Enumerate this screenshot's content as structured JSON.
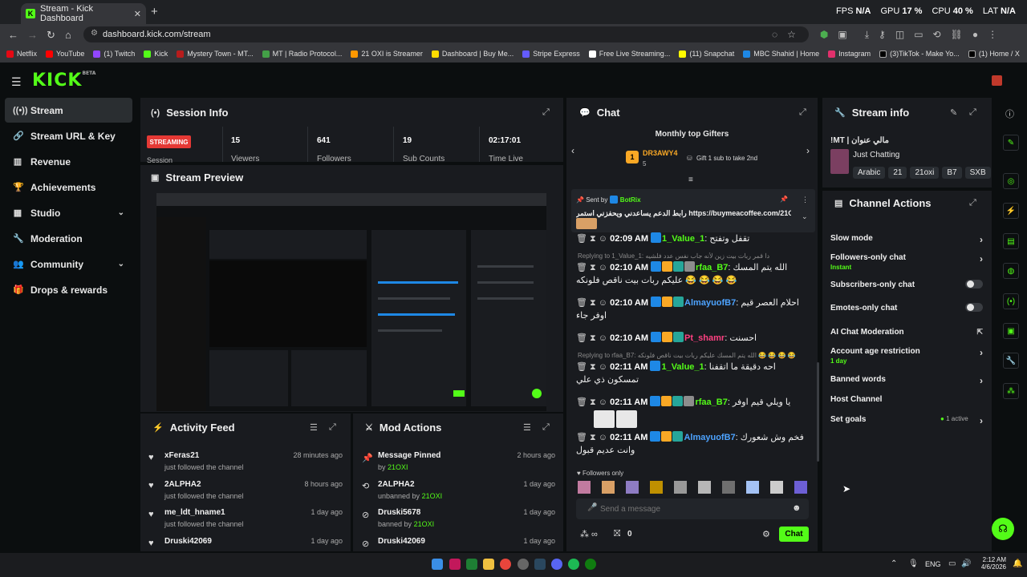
{
  "browser": {
    "tab_title": "Stream - Kick Dashboard",
    "url": "dashboard.kick.com/stream",
    "stats": {
      "fps_label": "FPS",
      "fps": "N/A",
      "gpu_label": "GPU",
      "gpu": "17 %",
      "cpu_label": "CPU",
      "cpu": "40 %",
      "lat_label": "LAT",
      "lat": "N/A"
    },
    "bookmarks": [
      "Netflix",
      "YouTube",
      "(1) Twitch",
      "Kick",
      "Mystery Town - MT...",
      "MT | Radio Protocol...",
      "21 OXI is Streamer",
      "Dashboard | Buy Me...",
      "Stripe Express",
      "Free Live Streaming...",
      "(11) Snapchat",
      "MBC Shahid | Home",
      "Instagram",
      "(3)TikTok - Make Yo...",
      "(1) Home / X"
    ]
  },
  "colors": {
    "accent": "#53fc18",
    "live": "#e53935",
    "panel": "#191b1f",
    "bg": "#0b0e0f"
  },
  "logo": {
    "text": "KICK",
    "sup": "BETA"
  },
  "sidebar": {
    "items": [
      {
        "label": "Stream",
        "icon": "broadcast-icon"
      },
      {
        "label": "Stream URL & Key",
        "icon": "link-icon"
      },
      {
        "label": "Revenue",
        "icon": "chart-icon"
      },
      {
        "label": "Achievements",
        "icon": "trophy-icon"
      },
      {
        "label": "Studio",
        "icon": "layout-icon"
      },
      {
        "label": "Moderation",
        "icon": "wrench-icon"
      },
      {
        "label": "Community",
        "icon": "users-icon"
      },
      {
        "label": "Drops & rewards",
        "icon": "gift-icon"
      }
    ]
  },
  "session": {
    "title": "Session Info",
    "status": "STREAMING",
    "session_label": "Session",
    "viewers": {
      "value": "15",
      "label": "Viewers"
    },
    "followers": {
      "value": "641",
      "label": "Followers"
    },
    "subs": {
      "value": "19",
      "label": "Sub Counts"
    },
    "time": {
      "value": "02:17:01",
      "label": "Time Live"
    }
  },
  "preview": {
    "title": "Stream Preview"
  },
  "activity": {
    "title": "Activity Feed",
    "items": [
      {
        "name": "xFeras21",
        "action": "just followed the channel",
        "time": "28 minutes ago"
      },
      {
        "name": "2ALPHA2",
        "action": "just followed the channel",
        "time": "8 hours ago"
      },
      {
        "name": "me_ldt_hname1",
        "action": "just followed the channel",
        "time": "1 day ago"
      },
      {
        "name": "Druski42069",
        "action": "",
        "time": "1 day ago"
      }
    ]
  },
  "mod": {
    "title": "Mod Actions",
    "items": [
      {
        "name": "Message Pinned",
        "prefix": "by",
        "by": "21OXI",
        "time": "2 hours ago"
      },
      {
        "name": "2ALPHA2",
        "prefix": "unbanned by",
        "by": "21OXI",
        "time": "1 day ago"
      },
      {
        "name": "Druski5678",
        "prefix": "banned by",
        "by": "21OXI",
        "time": "1 day ago"
      },
      {
        "name": "Druski42069",
        "prefix": "",
        "by": "",
        "time": "1 day ago"
      }
    ]
  },
  "chat": {
    "title": "Chat",
    "gifters_title": "Monthly top Gifters",
    "top_gifter": "DR3AWY4",
    "top_gifter_count": "5",
    "top_rank": "1",
    "gift_prompt": "Gift 1 sub to take 2nd",
    "pinned_sent_by": "Sent by",
    "pinned_user": "BotRix",
    "pinned_text": "رابط الدعم يساعدني ويحفزني استمر https://buymeacoffee.com/21OXI",
    "messages": [
      {
        "time": "02:09 AM",
        "user": "1_Value_1",
        "text": "تقفل وتفتح",
        "reply": ""
      },
      {
        "time": "02:10 AM",
        "user": "rfaa_B7",
        "text": "الله يتم المسك عليكم ربات بيت ناقص فلونكه 😂 😂 😂 😂",
        "reply": "Replying to 1_Value_1: دا قمر ربات بيت زين لأنه جاب نفس عدد فلشيه"
      },
      {
        "time": "02:10 AM",
        "user": "AlmayuofB7",
        "text": "احلام العصر قيم اوفر جاء",
        "reply": ""
      },
      {
        "time": "02:10 AM",
        "user": "Pt_shamr",
        "text": "احسنت",
        "reply": ""
      },
      {
        "time": "02:11 AM",
        "user": "1_Value_1",
        "text": "احه دقيقة ما اتقفنا تمسكون ذي علي",
        "reply": "Replying to rfaa_B7: الله يتم المسك عليكم ربات بيت ناقص فلونكه 😂 😂 😂 😂"
      },
      {
        "time": "02:11 AM",
        "user": "rfaa_B7",
        "text": "يا ويلي قيم اوفر",
        "reply": ""
      },
      {
        "time": "02:11 AM",
        "user": "AlmayuofB7",
        "text": "فخم وش شعورك وانت عديم قبول",
        "reply": ""
      }
    ],
    "followers_only": "Followers only",
    "input_placeholder": "Send a message",
    "points": "0",
    "send_label": "Chat"
  },
  "stream_info": {
    "title": "Stream info",
    "stream_title": "!MT | مالي عنوان",
    "category": "Just Chatting",
    "tags": [
      "Arabic",
      "21",
      "21oxi",
      "B7",
      "SXB"
    ]
  },
  "channel_actions": {
    "title": "Channel Actions",
    "items": [
      {
        "label": "Slow mode",
        "sub": "",
        "control": "arrow"
      },
      {
        "label": "Followers-only chat",
        "sub": "Instant",
        "control": "arrow"
      },
      {
        "label": "Subscribers-only chat",
        "sub": "",
        "control": "toggle"
      },
      {
        "label": "Emotes-only chat",
        "sub": "",
        "control": "toggle"
      },
      {
        "label": "AI Chat Moderation",
        "sub": "",
        "control": "external"
      },
      {
        "label": "Account age restriction",
        "sub": "1 day",
        "control": "arrow"
      },
      {
        "label": "Banned words",
        "sub": "",
        "control": "arrow"
      },
      {
        "label": "Host Channel",
        "sub": "",
        "control": "none"
      },
      {
        "label": "Set goals",
        "sub": "",
        "control": "arrow",
        "status": "1 active"
      }
    ]
  },
  "taskbar": {
    "lang": "ENG",
    "time": "2:12 AM",
    "date": "4/6/2026"
  }
}
